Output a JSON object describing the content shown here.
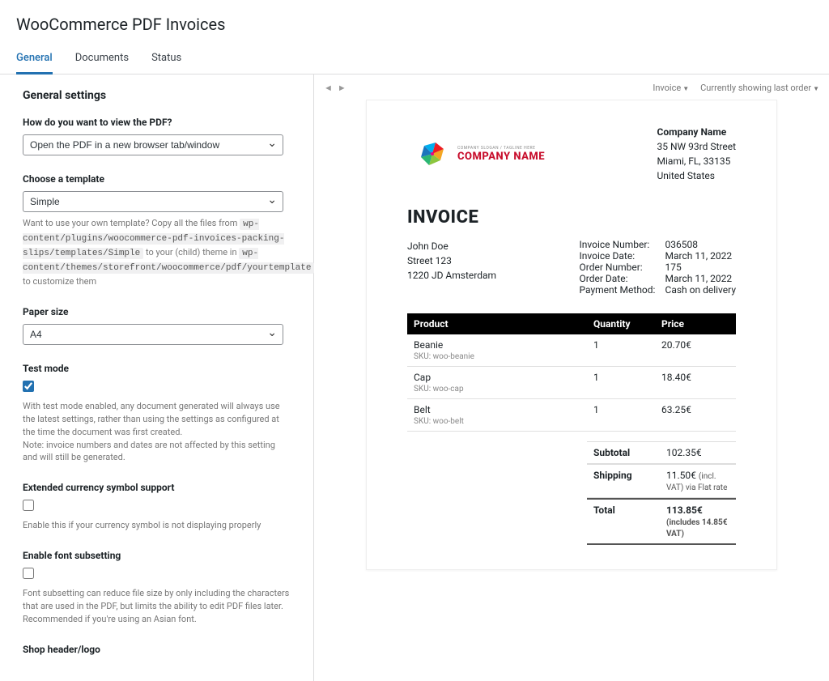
{
  "page_title": "WooCommerce PDF Invoices",
  "tabs": [
    {
      "label": "General",
      "active": true
    },
    {
      "label": "Documents",
      "active": false
    },
    {
      "label": "Status",
      "active": false
    }
  ],
  "panel_nav": {
    "invoice_label": "Invoice",
    "showing_label": "Currently showing last order"
  },
  "general": {
    "title": "General settings",
    "view_pdf": {
      "label": "How do you want to view the PDF?",
      "value": "Open the PDF in a new browser tab/window"
    },
    "template": {
      "label": "Choose a template",
      "value": "Simple",
      "help_pre": "Want to use your own template? Copy all the files from",
      "code1": "wp-content/plugins/woocommerce-pdf-invoices-packing-slips/templates/Simple",
      "help_mid": "to your (child) theme in",
      "code2": "wp-content/themes/storefront/woocommerce/pdf/yourtemplate",
      "help_post": "to customize them"
    },
    "paper": {
      "label": "Paper size",
      "value": "A4"
    },
    "test_mode": {
      "label": "Test mode",
      "checked": true,
      "help": "With test mode enabled, any document generated will always use the latest settings, rather than using the settings as configured at the time the document was first created.\nNote: invoice numbers and dates are not affected by this setting and will still be generated."
    },
    "currency": {
      "label": "Extended currency symbol support",
      "checked": false,
      "help": "Enable this if your currency symbol is not displaying properly"
    },
    "font_subset": {
      "label": "Enable font subsetting",
      "checked": false,
      "help": "Font subsetting can reduce file size by only including the characters that are used in the PDF, but limits the ability to edit PDF files later. Recommended if you're using an Asian font."
    },
    "shop_header": {
      "label": "Shop header/logo"
    }
  },
  "invoice": {
    "logo_name": "COMPANY NAME",
    "logo_tagline": "COMPANY SLOGAN / TAGLINE HERE",
    "company": {
      "name": "Company Name",
      "addr1": "35 NW 93rd Street",
      "addr2": "Miami, FL, 33135",
      "country": "United States"
    },
    "title": "INVOICE",
    "billto": {
      "name": "John Doe",
      "addr1": "Street 123",
      "addr2": "1220 JD Amsterdam"
    },
    "details": [
      {
        "k": "Invoice Number:",
        "v": "036508"
      },
      {
        "k": "Invoice Date:",
        "v": "March 11, 2022"
      },
      {
        "k": "Order Number:",
        "v": "175"
      },
      {
        "k": "Order Date:",
        "v": "March 11, 2022"
      },
      {
        "k": "Payment Method:",
        "v": "Cash on delivery"
      }
    ],
    "headers": {
      "product": "Product",
      "qty": "Quantity",
      "price": "Price"
    },
    "items": [
      {
        "name": "Beanie",
        "sku": "SKU:  woo-beanie",
        "qty": "1",
        "price": "20.70€"
      },
      {
        "name": "Cap",
        "sku": "SKU:  woo-cap",
        "qty": "1",
        "price": "18.40€"
      },
      {
        "name": "Belt",
        "sku": "SKU:  woo-belt",
        "qty": "1",
        "price": "63.25€"
      }
    ],
    "totals": {
      "subtotal_label": "Subtotal",
      "subtotal": "102.35€",
      "shipping_label": "Shipping",
      "shipping": "11.50€",
      "shipping_note": "(incl. VAT) via Flat rate",
      "total_label": "Total",
      "total": "113.85€",
      "total_note": "(includes 14.85€ VAT)"
    }
  }
}
